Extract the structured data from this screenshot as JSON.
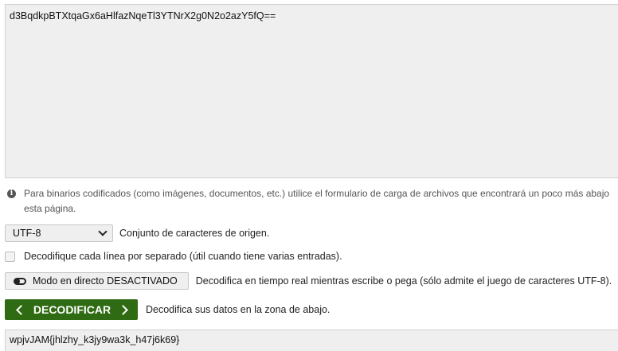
{
  "input": {
    "value": "d3BqdkpBTXtqaGx6aHlfazNqeTl3YTNrX2g0N2o2azY5fQ=="
  },
  "info": {
    "icon": "info-icon",
    "text": "Para binarios codificados (como imágenes, documentos, etc.) utilice el formulario de carga de archivos que encontrará un poco más abajo esta página."
  },
  "charset": {
    "selected": "UTF-8",
    "label": "Conjunto de caracteres de origen."
  },
  "line_option": {
    "checked": false,
    "label": "Decodifique cada línea por separado (útil cuando tiene varias entradas)."
  },
  "live_mode": {
    "button_label": "Modo en directo DESACTIVADO",
    "icon": "toggle-off-icon",
    "description": "Decodifica en tiempo real mientras escribe o pega (sólo admite el juego de caracteres UTF-8)."
  },
  "decode": {
    "button_label": "DECODIFICAR",
    "description": "Decodifica sus datos en la zona de abajo.",
    "color": "#2e6b12"
  },
  "output": {
    "value": "wpjvJAM{jhlzhy_k3jy9wa3k_h47j6k69}"
  }
}
